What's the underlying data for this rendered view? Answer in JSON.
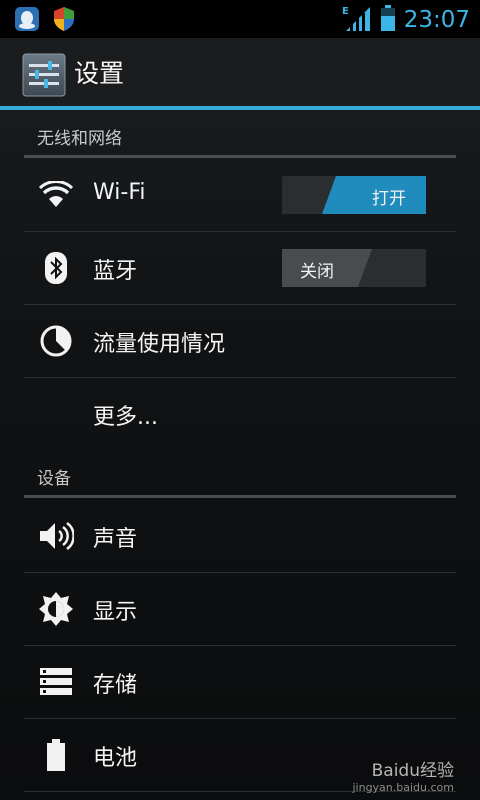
{
  "status_bar": {
    "time": "23:07",
    "network_type": "E",
    "accent_color": "#3bb6e6"
  },
  "action_bar": {
    "title": "设置",
    "icon": "settings-sliders-icon",
    "underline_color": "#36a9d8"
  },
  "sections": {
    "wireless": {
      "header": "无线和网络",
      "items": [
        {
          "label": "Wi-Fi",
          "icon": "wifi-icon",
          "toggle": "打开",
          "toggle_state": "on"
        },
        {
          "label": "蓝牙",
          "icon": "bluetooth-icon",
          "toggle": "关闭",
          "toggle_state": "off"
        },
        {
          "label": "流量使用情况",
          "icon": "data-usage-icon"
        },
        {
          "label": "更多..."
        }
      ]
    },
    "device": {
      "header": "设备",
      "items": [
        {
          "label": "声音",
          "icon": "speaker-icon"
        },
        {
          "label": "显示",
          "icon": "brightness-icon"
        },
        {
          "label": "存储",
          "icon": "storage-icon"
        },
        {
          "label": "电池",
          "icon": "battery-icon"
        }
      ]
    }
  },
  "watermark": {
    "brand": "Baidu经验",
    "url": "jingyan.baidu.com"
  }
}
